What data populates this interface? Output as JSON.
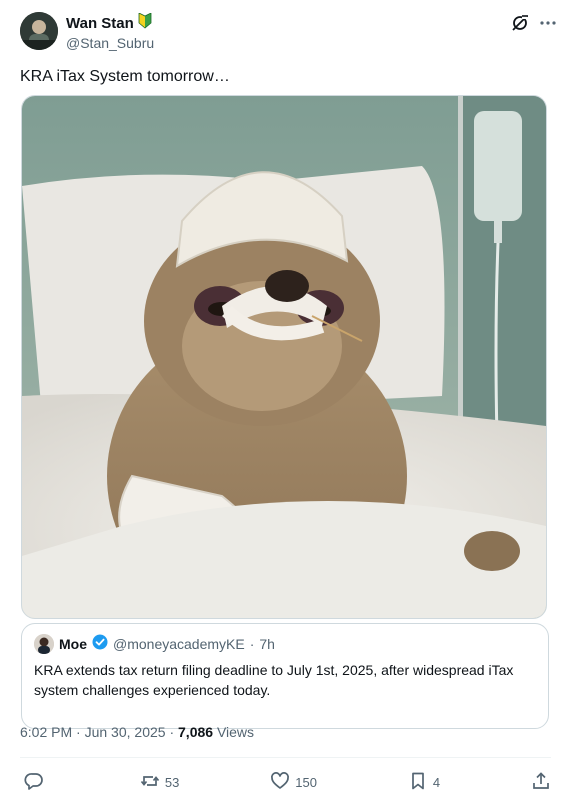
{
  "author": {
    "display_name": "Wan Stan",
    "handle": "@Stan_Subru",
    "badge": "🔰"
  },
  "tweet": {
    "text": "KRA iTax System tomorrow…"
  },
  "quote": {
    "name": "Moe",
    "handle": "@moneyacademyKE",
    "dot": "·",
    "time": "7h",
    "text": "KRA extends tax return filing deadline to July 1st, 2025, after widespread iTax system challenges experienced today."
  },
  "meta": {
    "time": "6:02 PM",
    "sep1": "·",
    "date": "Jun 30, 2025",
    "sep2": "·",
    "views_count": "7,086",
    "views_label": "Views"
  },
  "actions": {
    "reply_count": "",
    "repost_count": "53",
    "like_count": "150",
    "bookmark_count": "4"
  },
  "colors": {
    "accent": "#1d9bf0",
    "muted": "#536471",
    "text": "#0f1419"
  }
}
